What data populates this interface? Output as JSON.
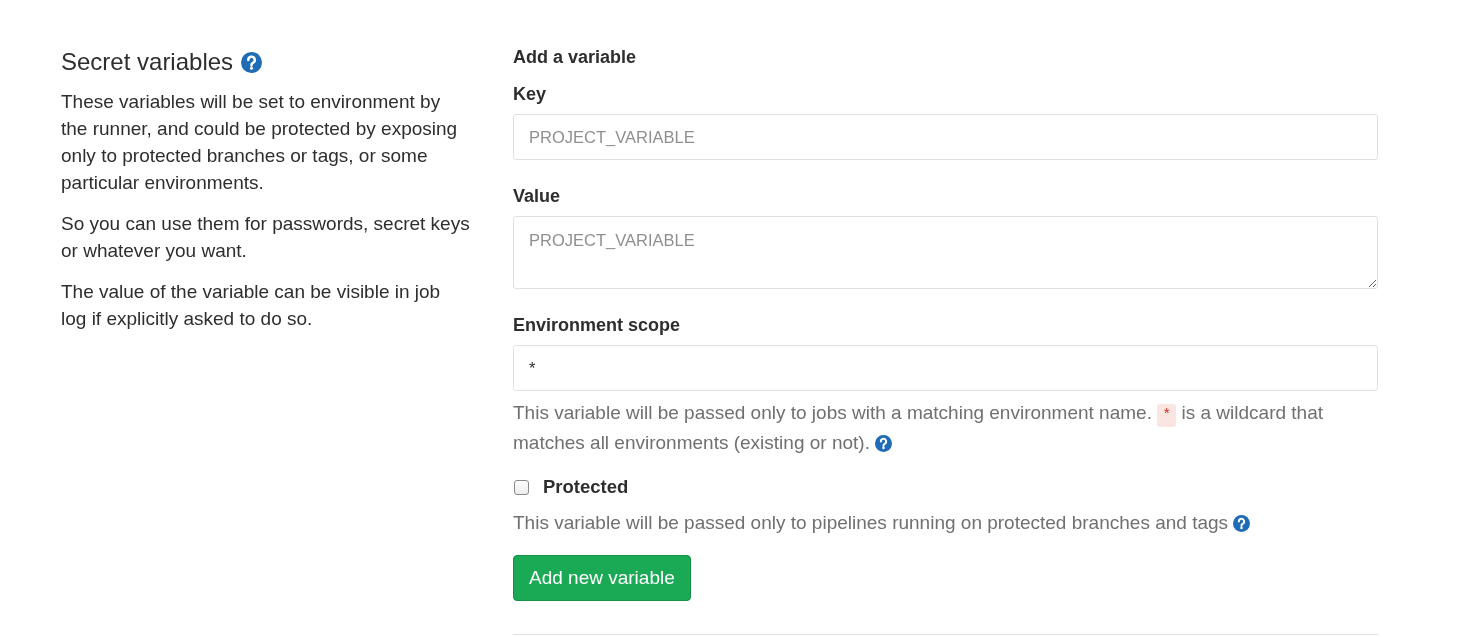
{
  "sidebar": {
    "title": "Secret variables",
    "paragraphs": [
      "These variables will be set to environment by the runner, and could be protected by exposing only to protected branches or tags, or some particular environments.",
      "So you can use them for passwords, secret keys or whatever you want.",
      "The value of the variable can be visible in job log if explicitly asked to do so."
    ]
  },
  "form": {
    "heading": "Add a variable",
    "fields": [
      {
        "kind": "input",
        "label": "Key",
        "placeholder": "PROJECT_VARIABLE"
      },
      {
        "kind": "textarea",
        "label": "Value",
        "placeholder": "PROJECT_VARIABLE"
      },
      {
        "kind": "input",
        "label": "Environment scope",
        "value": "*",
        "help": [
          {
            "kind": "text",
            "text": "This variable will be passed only to jobs with a matching environment name."
          },
          {
            "kind": "code",
            "text": "*"
          },
          {
            "kind": "text",
            "text": "is a wildcard that matches all environments (existing or not)."
          }
        ]
      }
    ],
    "protected": {
      "label": "Protected",
      "checked": false,
      "help": "This variable will be passed only to pipelines running on protected branches and tags"
    },
    "submit_button": "Add new variable"
  }
}
